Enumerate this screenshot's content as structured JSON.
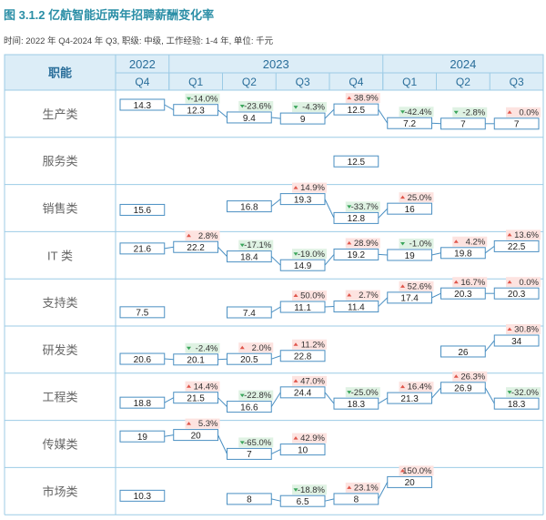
{
  "header": {
    "title": "图 3.1.2  亿航智能近两年招聘薪酬变化率",
    "subtitle": "时间: 2022 年 Q4-2024 年 Q3, 职级: 中级, 工作经验: 1-4 年, 单位: 千元"
  },
  "colors": {
    "header_bg": "#dcedf7",
    "border": "#9ccbe6",
    "box_border": "#4a8fc2",
    "up_bg": "#fde3e0",
    "up_arrow": "#e0554a",
    "down_bg": "#dff2e3",
    "down_arrow": "#3aa55a",
    "label_color": "#666666",
    "header_text": "#2a6e9a"
  },
  "chart_data": {
    "type": "table",
    "row_header": "职能",
    "year_groups": [
      {
        "year": "2022",
        "span": 1
      },
      {
        "year": "2023",
        "span": 4
      },
      {
        "year": "2024",
        "span": 3
      }
    ],
    "quarters": [
      "Q4",
      "Q1",
      "Q2",
      "Q3",
      "Q4",
      "Q1",
      "Q2",
      "Q3"
    ],
    "rows": [
      {
        "name": "生产类",
        "values": [
          14.3,
          12.3,
          9.4,
          9,
          12.5,
          7.2,
          7,
          7
        ],
        "changes": [
          null,
          "-14.0%",
          "-23.6%",
          "-4.3%",
          "38.9%",
          "-42.4%",
          "-2.8%",
          "0.0%"
        ]
      },
      {
        "name": "服务类",
        "values": [
          null,
          null,
          null,
          null,
          12.5,
          null,
          null,
          null
        ],
        "changes": [
          null,
          null,
          null,
          null,
          null,
          null,
          null,
          null
        ]
      },
      {
        "name": "销售类",
        "values": [
          15.6,
          null,
          16.8,
          19.3,
          12.8,
          16,
          null,
          null
        ],
        "changes": [
          null,
          null,
          null,
          "14.9%",
          "-33.7%",
          "25.0%",
          null,
          null
        ]
      },
      {
        "name": "IT 类",
        "values": [
          21.6,
          22.2,
          18.4,
          14.9,
          19.2,
          19,
          19.8,
          22.5
        ],
        "changes": [
          null,
          "2.8%",
          "-17.1%",
          "-19.0%",
          "28.9%",
          "-1.0%",
          "4.2%",
          "13.6%"
        ]
      },
      {
        "name": "支持类",
        "values": [
          7.5,
          null,
          7.4,
          11.1,
          11.4,
          17.4,
          20.3,
          20.3
        ],
        "changes": [
          null,
          null,
          null,
          "50.0%",
          "2.7%",
          "52.6%",
          "16.7%",
          "0.0%"
        ]
      },
      {
        "name": "研发类",
        "values": [
          20.6,
          20.1,
          20.5,
          22.8,
          null,
          null,
          26,
          34
        ],
        "changes": [
          null,
          "-2.4%",
          "2.0%",
          "11.2%",
          null,
          null,
          null,
          "30.8%"
        ]
      },
      {
        "name": "工程类",
        "values": [
          18.8,
          21.5,
          16.6,
          24.4,
          18.3,
          21.3,
          26.9,
          18.3
        ],
        "changes": [
          null,
          "14.4%",
          "-22.8%",
          "47.0%",
          "-25.0%",
          "16.4%",
          "26.3%",
          "-32.0%"
        ]
      },
      {
        "name": "传媒类",
        "values": [
          19,
          20,
          7,
          10,
          null,
          null,
          null,
          null
        ],
        "changes": [
          null,
          "5.3%",
          "-65.0%",
          "42.9%",
          null,
          null,
          null,
          null
        ]
      },
      {
        "name": "市场类",
        "values": [
          10.3,
          null,
          8,
          6.5,
          8,
          20,
          null,
          null
        ],
        "changes": [
          null,
          null,
          null,
          "-18.8%",
          "23.1%",
          "150.0%",
          null,
          null
        ]
      }
    ]
  }
}
